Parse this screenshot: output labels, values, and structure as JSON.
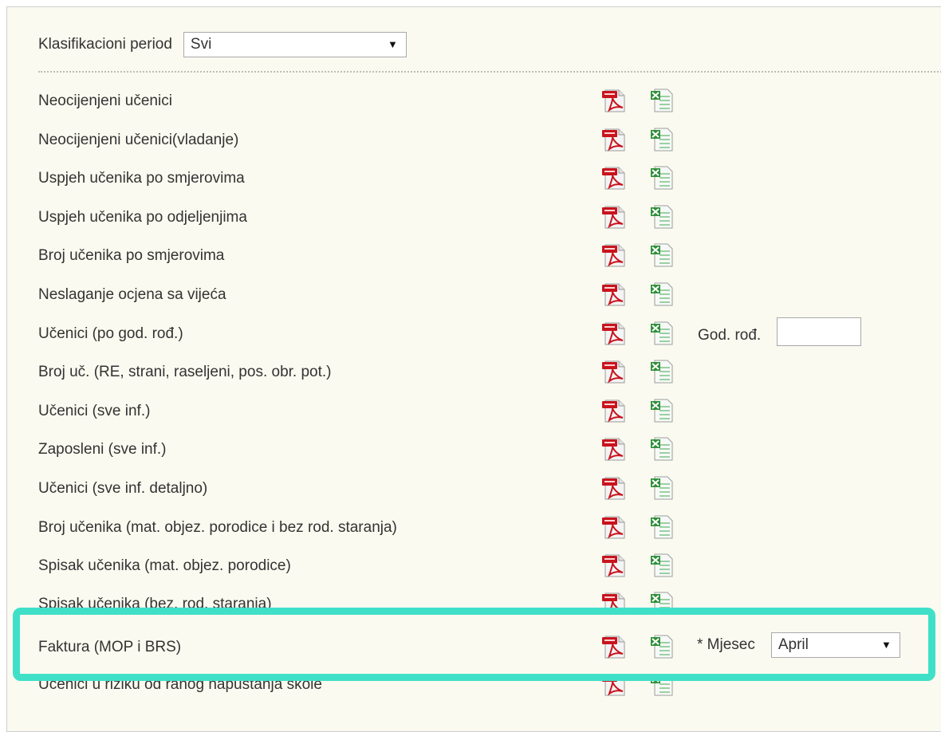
{
  "filter": {
    "label": "Klasifikacioni period",
    "selected": "Svi"
  },
  "reports": [
    {
      "label": "Neocijenjeni učenici"
    },
    {
      "label": "Neocijenjeni učenici(vladanje)"
    },
    {
      "label": "Uspjeh učenika po smjerovima"
    },
    {
      "label": "Uspjeh učenika po odjeljenjima"
    },
    {
      "label": "Broj učenika po smjerovima"
    },
    {
      "label": "Neslaganje ocjena sa vijeća"
    },
    {
      "label": "Učenici (po god. rođ.)",
      "extra_label": "God. rođ.",
      "extra_value": ""
    },
    {
      "label": "Broj uč. (RE, strani, raseljeni, pos. obr. pot.)"
    },
    {
      "label": "Učenici (sve inf.)"
    },
    {
      "label": "Zaposleni (sve inf.)"
    },
    {
      "label": "Učenici (sve inf. detaljno)"
    },
    {
      "label": "Broj učenika (mat. objez. porodice i bez rod. staranja)"
    },
    {
      "label": "Spisak učenika (mat. objez. porodice)"
    }
  ],
  "clipped_row": {
    "label": "Spisak učenika (bez. rod. staranja)"
  },
  "highlighted_row": {
    "label": "Faktura (MOP i BRS)",
    "extra_label": "* Mjesec",
    "month_selected": "April"
  },
  "last_row": {
    "label": "Učenici u riziku od ranog napuštanja škole"
  },
  "icons": {
    "pdf": "pdf-icon",
    "excel": "excel-icon"
  },
  "colors": {
    "panel_background": "#fbfaf0",
    "highlight_border": "#40e0c8",
    "pdf_red": "#c8141e",
    "excel_green": "#2f8f3a"
  }
}
